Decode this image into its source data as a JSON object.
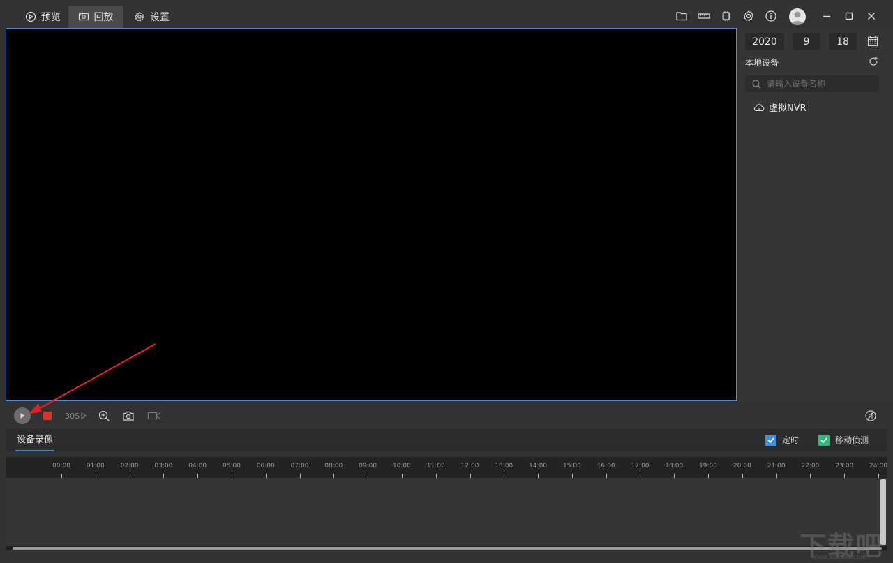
{
  "tabs": [
    {
      "label": "预览",
      "icon": "play-circle-icon"
    },
    {
      "label": "回放",
      "icon": "camera-replay-icon",
      "active": true
    },
    {
      "label": "设置",
      "icon": "gear-icon"
    }
  ],
  "toolbar_icons": [
    "folder-icon",
    "ruler-icon",
    "chip-icon",
    "gear-icon",
    "info-icon",
    "avatar",
    "minimize-icon",
    "maximize-icon",
    "close-icon"
  ],
  "date": {
    "year": "2020",
    "month": "9",
    "day": "18"
  },
  "side": {
    "title": "本地设备",
    "search_placeholder": "请输入设备名称",
    "devices": [
      {
        "label": "虚拟NVR",
        "icon": "nvr-cloud-icon"
      }
    ]
  },
  "controls": {
    "speed_label": "30S"
  },
  "recording": {
    "tab_label": "设备录像",
    "filters": [
      {
        "label": "定时",
        "checked": true,
        "color": "#3c8ee0"
      },
      {
        "label": "移动侦测",
        "checked": true,
        "color": "#2fb67d"
      }
    ]
  },
  "timeline": {
    "labels": [
      "00:00",
      "01:00",
      "02:00",
      "03:00",
      "04:00",
      "05:00",
      "06:00",
      "07:00",
      "08:00",
      "09:00",
      "10:00",
      "11:00",
      "12:00",
      "13:00",
      "14:00",
      "15:00",
      "16:00",
      "17:00",
      "18:00",
      "19:00",
      "20:00",
      "21:00",
      "22:00",
      "23:00",
      "24:00"
    ]
  },
  "watermark": {
    "text": "下载吧",
    "url": "www.xiazaiba.com"
  },
  "colors": {
    "accent": "#3c8ee0",
    "stop": "#d9362a",
    "arrow": "#e02020"
  }
}
